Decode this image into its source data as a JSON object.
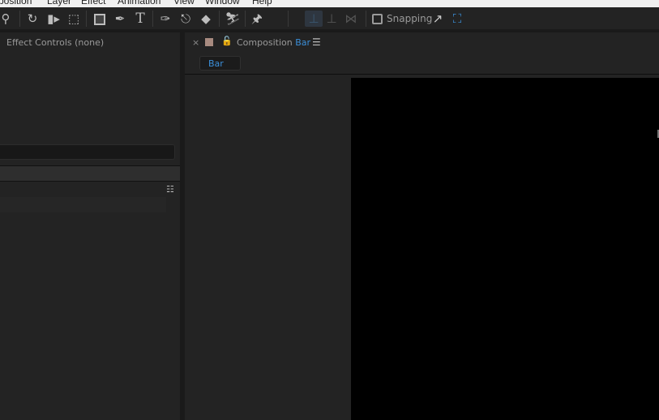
{
  "menu": [
    "position",
    "Layer",
    "Effect",
    "Animation",
    "View",
    "Window",
    "Help"
  ],
  "toolbar": {
    "snapping_label": "Snapping",
    "snapping_checked": false
  },
  "left_panel": {
    "title": "Effect Controls (none)"
  },
  "composition_panel": {
    "close": "×",
    "title_prefix": "Composition",
    "comp_name": "Bar",
    "label_color": "#a88b80",
    "menu_icon": "☰",
    "tab_label": "Bar",
    "accent": "#3b8fd9"
  }
}
